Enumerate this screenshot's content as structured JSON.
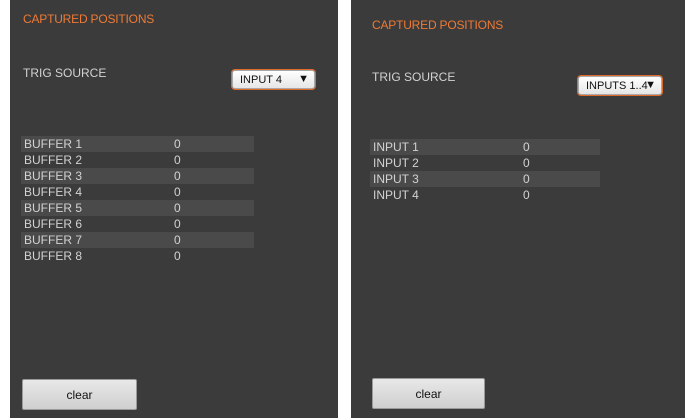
{
  "left": {
    "title": "CAPTURED POSITIONS",
    "trig_label": "TRIG SOURCE",
    "select_value": "INPUT 4",
    "arrow": "▼",
    "rows": [
      {
        "name": "BUFFER 1",
        "value": "0"
      },
      {
        "name": "BUFFER 2",
        "value": "0"
      },
      {
        "name": "BUFFER 3",
        "value": "0"
      },
      {
        "name": "BUFFER 4",
        "value": "0"
      },
      {
        "name": "BUFFER 5",
        "value": "0"
      },
      {
        "name": "BUFFER 6",
        "value": "0"
      },
      {
        "name": "BUFFER 7",
        "value": "0"
      },
      {
        "name": "BUFFER 8",
        "value": "0"
      }
    ],
    "clear_label": "clear"
  },
  "right": {
    "title": "CAPTURED POSITIONS",
    "trig_label": "TRIG SOURCE",
    "select_value": "INPUTS 1..4",
    "arrow": "▼",
    "rows": [
      {
        "name": "INPUT 1",
        "value": "0"
      },
      {
        "name": "INPUT 2",
        "value": "0"
      },
      {
        "name": "INPUT 3",
        "value": "0"
      },
      {
        "name": "INPUT 4",
        "value": "0"
      }
    ],
    "clear_label": "clear"
  },
  "colors": {
    "panel_bg": "#3b3b3b",
    "accent": "#ee7a35",
    "text": "#d2d2d2",
    "row_shade": "#4a4a4a"
  }
}
